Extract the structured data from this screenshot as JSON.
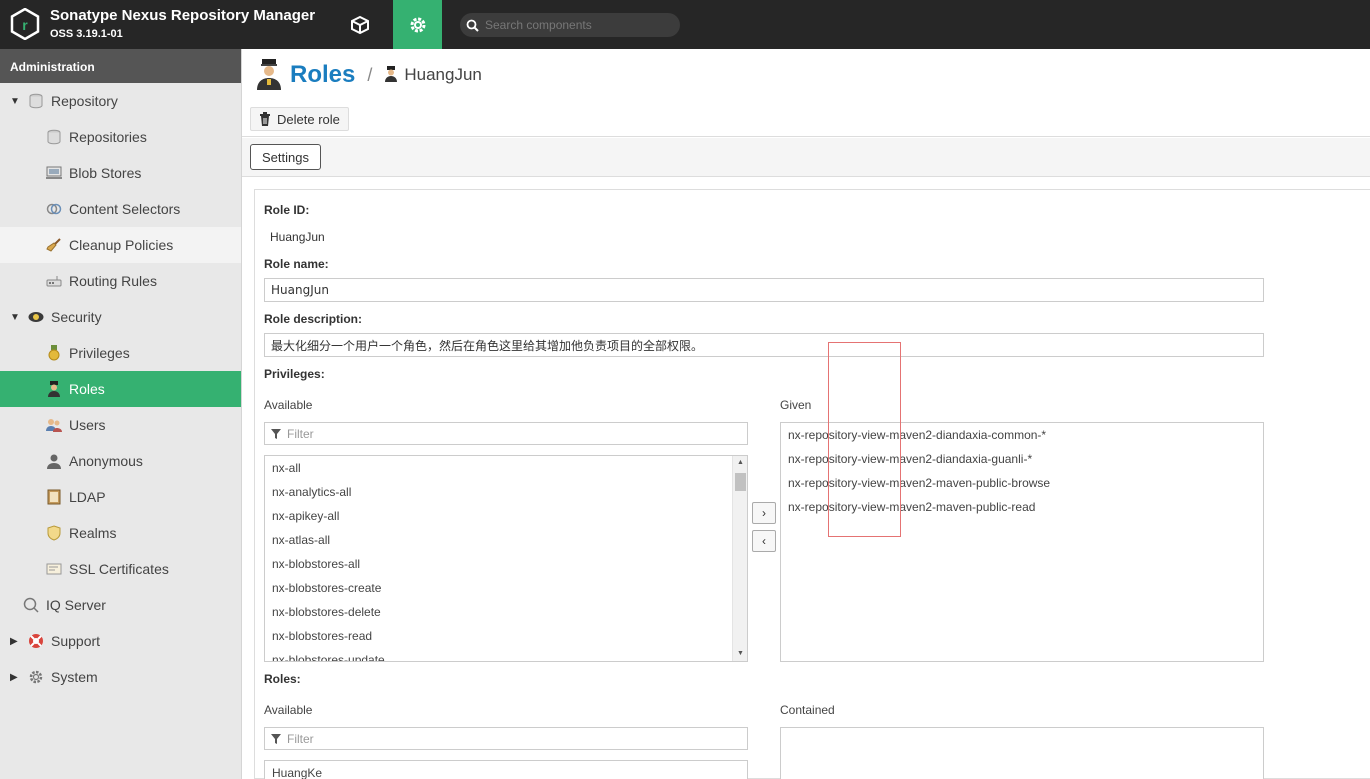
{
  "header": {
    "title": "Sonatype Nexus Repository Manager",
    "version": "OSS 3.19.1-01",
    "search_placeholder": "Search components"
  },
  "sidebar": {
    "heading": "Administration",
    "items": [
      {
        "label": "Repository",
        "icon": "database-icon"
      },
      {
        "label": "Repositories",
        "icon": "database-icon"
      },
      {
        "label": "Blob Stores",
        "icon": "server-icon"
      },
      {
        "label": "Content Selectors",
        "icon": "selector-icon"
      },
      {
        "label": "Cleanup Policies",
        "icon": "broom-icon"
      },
      {
        "label": "Routing Rules",
        "icon": "router-icon"
      },
      {
        "label": "Security",
        "icon": "security-badge-icon"
      },
      {
        "label": "Privileges",
        "icon": "medal-icon"
      },
      {
        "label": "Roles",
        "icon": "officer-icon"
      },
      {
        "label": "Users",
        "icon": "users-icon"
      },
      {
        "label": "Anonymous",
        "icon": "user-silhouette-icon"
      },
      {
        "label": "LDAP",
        "icon": "book-icon"
      },
      {
        "label": "Realms",
        "icon": "shield-icon"
      },
      {
        "label": "SSL Certificates",
        "icon": "certificate-icon"
      },
      {
        "label": "IQ Server",
        "icon": "iq-icon"
      },
      {
        "label": "Support",
        "icon": "lifebuoy-icon"
      },
      {
        "label": "System",
        "icon": "gear-icon"
      }
    ]
  },
  "breadcrumb": {
    "section": "Roles",
    "separator": "/",
    "current": "HuangJun"
  },
  "toolbar": {
    "delete_label": "Delete role"
  },
  "tabs": {
    "settings": "Settings"
  },
  "form": {
    "role_id_label": "Role ID:",
    "role_id_value": "HuangJun",
    "role_name_label": "Role name:",
    "role_name_value": "HuangJun",
    "role_description_label": "Role description:",
    "role_description_value": "最大化细分一个用户一个角色，然后在角色这里给其增加他负责项目的全部权限。",
    "privileges_label": "Privileges:",
    "privileges_available_label": "Available",
    "privileges_given_label": "Given",
    "filter_placeholder": "Filter",
    "available_privileges": [
      "nx-all",
      "nx-analytics-all",
      "nx-apikey-all",
      "nx-atlas-all",
      "nx-blobstores-all",
      "nx-blobstores-create",
      "nx-blobstores-delete",
      "nx-blobstores-read",
      "nx-blobstores-update"
    ],
    "given_privileges": [
      "nx-repository-view-maven2-diandaxia-common-*",
      "nx-repository-view-maven2-diandaxia-guanli-*",
      "nx-repository-view-maven2-maven-public-browse",
      "nx-repository-view-maven2-maven-public-read"
    ],
    "move_right": "›",
    "move_left": "‹",
    "roles_label": "Roles:",
    "roles_available_label": "Available",
    "roles_contained_label": "Contained",
    "available_roles": [
      "HuangKe"
    ]
  },
  "colors": {
    "accent": "#35b171",
    "title_blue": "#1a7dbf",
    "topbar": "#262626",
    "highlight_box": "#e57373"
  }
}
